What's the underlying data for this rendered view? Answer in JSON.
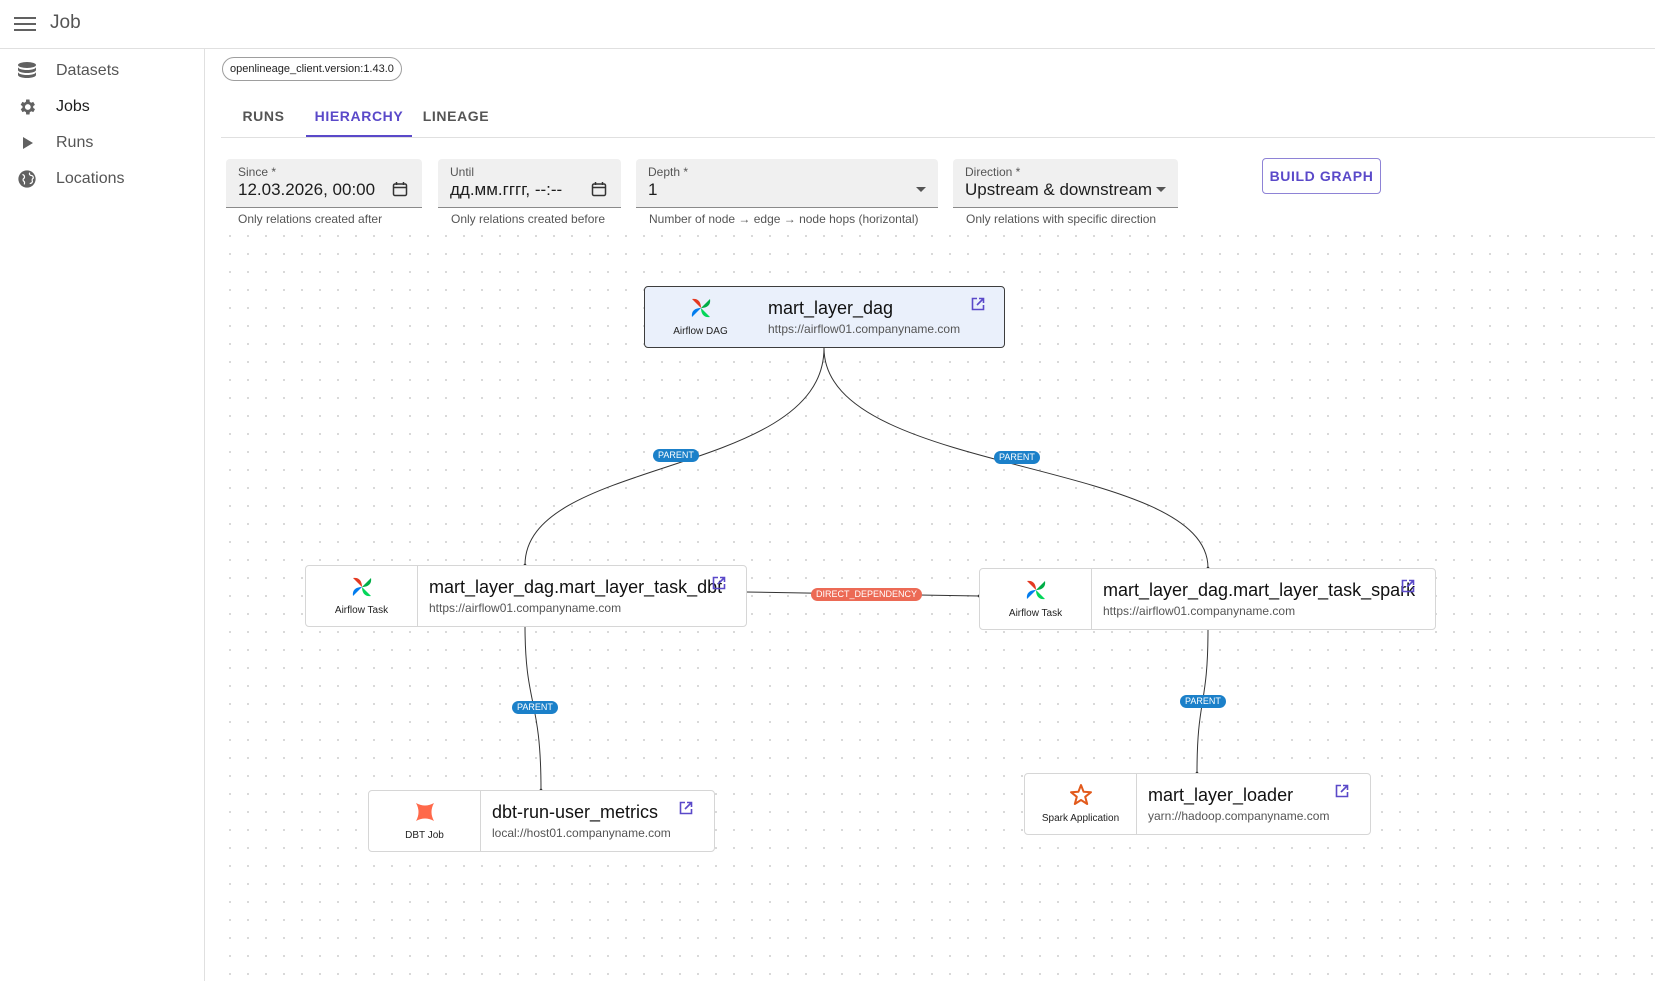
{
  "appbar": {
    "title": "Job"
  },
  "sidebar": {
    "items": [
      {
        "label": "Datasets",
        "icon": "database-icon"
      },
      {
        "label": "Jobs",
        "icon": "gear-icon"
      },
      {
        "label": "Runs",
        "icon": "play-icon"
      },
      {
        "label": "Locations",
        "icon": "globe-icon"
      }
    ],
    "active": "Jobs"
  },
  "chip": {
    "label": "openlineage_client.version:1.43.0"
  },
  "tabs": [
    {
      "label": "RUNS"
    },
    {
      "label": "HIERARCHY"
    },
    {
      "label": "LINEAGE"
    }
  ],
  "active_tab": "HIERARCHY",
  "filters": {
    "since": {
      "label": "Since *",
      "value": "12.03.2026, 00:00",
      "helper": "Only relations created after"
    },
    "until": {
      "label": "Until",
      "value": "дд.мм.гггг, --:--",
      "helper": "Only relations created before"
    },
    "depth": {
      "label": "Depth *",
      "value": "1",
      "helper": "Number of node → edge → node hops (horizontal)"
    },
    "direction": {
      "label": "Direction *",
      "value": "Upstream & downstream",
      "helper": "Only relations with specific direction"
    },
    "build_label": "BUILD GRAPH"
  },
  "graph": {
    "nodes": {
      "dag": {
        "type": "Airflow DAG",
        "name": "mart_layer_dag",
        "url": "https://airflow01.companyname.com"
      },
      "task_dbt": {
        "type": "Airflow Task",
        "name": "mart_layer_dag.mart_layer_task_dbt",
        "url": "https://airflow01.companyname.com"
      },
      "task_spark": {
        "type": "Airflow Task",
        "name": "mart_layer_dag.mart_layer_task_spark",
        "url": "https://airflow01.companyname.com"
      },
      "dbt_job": {
        "type": "DBT Job",
        "name": "dbt-run-user_metrics",
        "url": "local://host01.companyname.com"
      },
      "spark_app": {
        "type": "Spark Application",
        "name": "mart_layer_loader",
        "url": "yarn://hadoop.companyname.com"
      }
    },
    "edges": {
      "dag_dbt": "PARENT",
      "dag_spark": "PARENT",
      "dbt_spark": "DIRECT_DEPENDENCY",
      "dbt_job": "PARENT",
      "spark_app": "PARENT"
    }
  },
  "colors": {
    "accent": "#5a49c9",
    "parent_edge": "#1b80c9",
    "dependency_edge": "#ec6a55",
    "selected_node_bg": "#eaf0fb"
  }
}
